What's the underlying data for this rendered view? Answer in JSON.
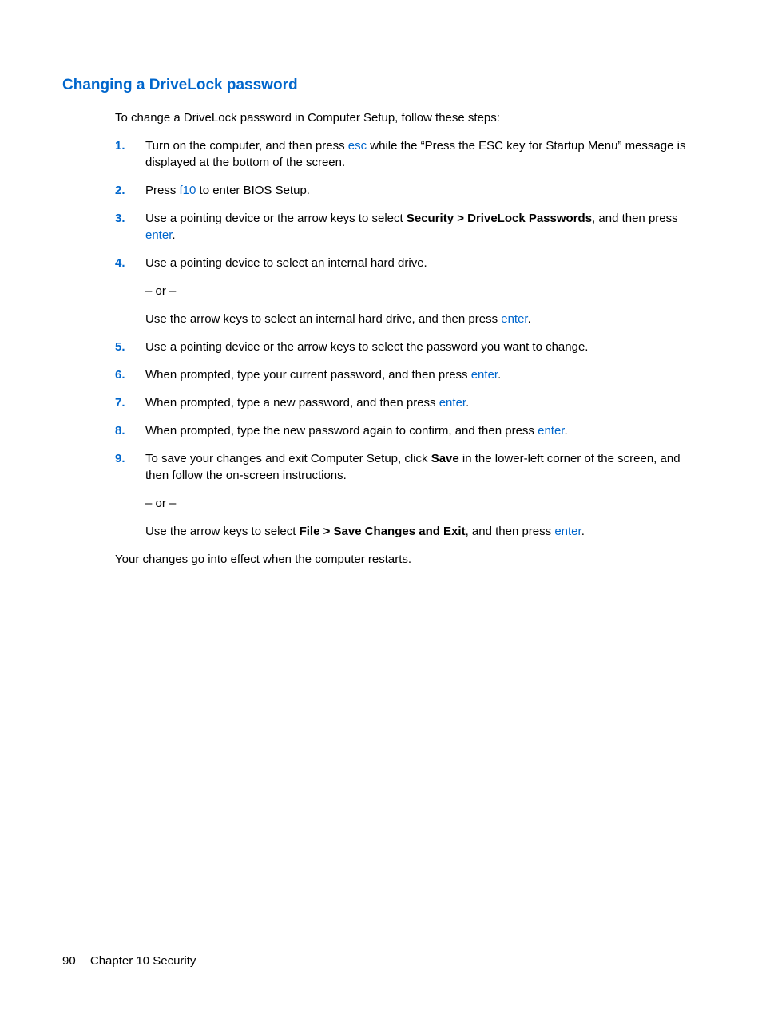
{
  "heading": "Changing a DriveLock password",
  "intro": "To change a DriveLock password in Computer Setup, follow these steps:",
  "steps": [
    {
      "num": "1.",
      "parts": [
        {
          "type": "text",
          "value": "Turn on the computer, and then press "
        },
        {
          "type": "key",
          "value": "esc"
        },
        {
          "type": "text",
          "value": " while the “Press the ESC key for Startup Menu” message is displayed at the bottom of the screen."
        }
      ]
    },
    {
      "num": "2.",
      "parts": [
        {
          "type": "text",
          "value": "Press "
        },
        {
          "type": "key",
          "value": "f10"
        },
        {
          "type": "text",
          "value": " to enter BIOS Setup."
        }
      ]
    },
    {
      "num": "3.",
      "parts": [
        {
          "type": "text",
          "value": "Use a pointing device or the arrow keys to select "
        },
        {
          "type": "bold",
          "value": "Security > DriveLock Passwords"
        },
        {
          "type": "text",
          "value": ", and then press "
        },
        {
          "type": "key",
          "value": "enter"
        },
        {
          "type": "text",
          "value": "."
        }
      ]
    },
    {
      "num": "4.",
      "blocks": [
        [
          {
            "type": "text",
            "value": "Use a pointing device to select an internal hard drive."
          }
        ],
        [
          {
            "type": "text",
            "value": "– or –"
          }
        ],
        [
          {
            "type": "text",
            "value": "Use the arrow keys to select an internal hard drive, and then press "
          },
          {
            "type": "key",
            "value": "enter"
          },
          {
            "type": "text",
            "value": "."
          }
        ]
      ]
    },
    {
      "num": "5.",
      "parts": [
        {
          "type": "text",
          "value": "Use a pointing device or the arrow keys to select the password you want to change."
        }
      ]
    },
    {
      "num": "6.",
      "parts": [
        {
          "type": "text",
          "value": "When prompted, type your current password, and then press "
        },
        {
          "type": "key",
          "value": "enter"
        },
        {
          "type": "text",
          "value": "."
        }
      ]
    },
    {
      "num": "7.",
      "parts": [
        {
          "type": "text",
          "value": "When prompted, type a new password, and then press "
        },
        {
          "type": "key",
          "value": "enter"
        },
        {
          "type": "text",
          "value": "."
        }
      ]
    },
    {
      "num": "8.",
      "parts": [
        {
          "type": "text",
          "value": "When prompted, type the new password again to confirm, and then press "
        },
        {
          "type": "key",
          "value": "enter"
        },
        {
          "type": "text",
          "value": "."
        }
      ]
    },
    {
      "num": "9.",
      "blocks": [
        [
          {
            "type": "text",
            "value": "To save your changes and exit Computer Setup, click "
          },
          {
            "type": "bold",
            "value": "Save"
          },
          {
            "type": "text",
            "value": " in the lower-left corner of the screen, and then follow the on-screen instructions."
          }
        ],
        [
          {
            "type": "text",
            "value": "– or –"
          }
        ],
        [
          {
            "type": "text",
            "value": "Use the arrow keys to select "
          },
          {
            "type": "bold",
            "value": "File > Save Changes and Exit"
          },
          {
            "type": "text",
            "value": ", and then press "
          },
          {
            "type": "key",
            "value": "enter"
          },
          {
            "type": "text",
            "value": "."
          }
        ]
      ]
    }
  ],
  "closing": "Your changes go into effect when the computer restarts.",
  "footer": {
    "page": "90",
    "chapter": "Chapter 10   Security"
  }
}
